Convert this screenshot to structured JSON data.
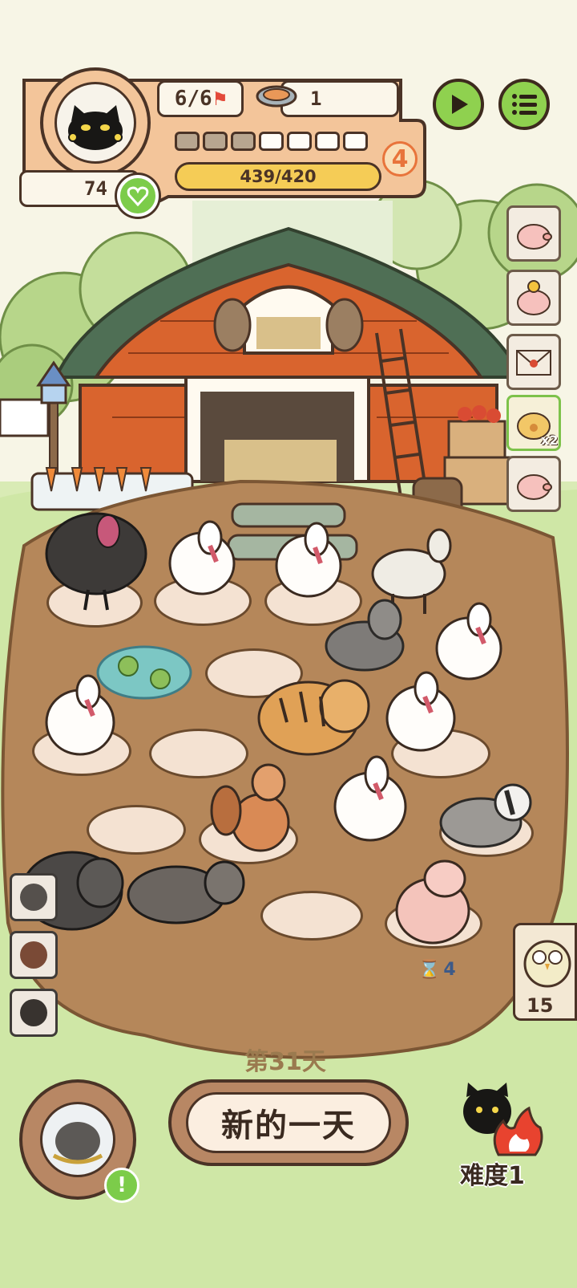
{
  "hud": {
    "level_progress": "6/6",
    "food_count": "1",
    "stamina_segments_total": 7,
    "stamina_segments_filled": 3,
    "level_badge": "4",
    "xp_text": "439/420",
    "heart_value": "74"
  },
  "timer_badge": "4",
  "owl_counter": "15",
  "side_cards": [
    {
      "icon": "piggy-bank-icon"
    },
    {
      "icon": "piggy-bank-coin-icon"
    },
    {
      "icon": "envelope-icon"
    },
    {
      "icon": "paw-pouch-icon",
      "multiplier": "x2"
    },
    {
      "icon": "piggy-bank-icon"
    }
  ],
  "day_label": "第31天",
  "new_day_button": "新的一天",
  "difficulty_label": "难度1",
  "colors": {
    "accent_green": "#8fd14f",
    "level_badge_orange": "#e8743b",
    "xp_yellow": "#f5cc56",
    "barn_red": "#d9642e",
    "dirt": "#b5875a"
  }
}
